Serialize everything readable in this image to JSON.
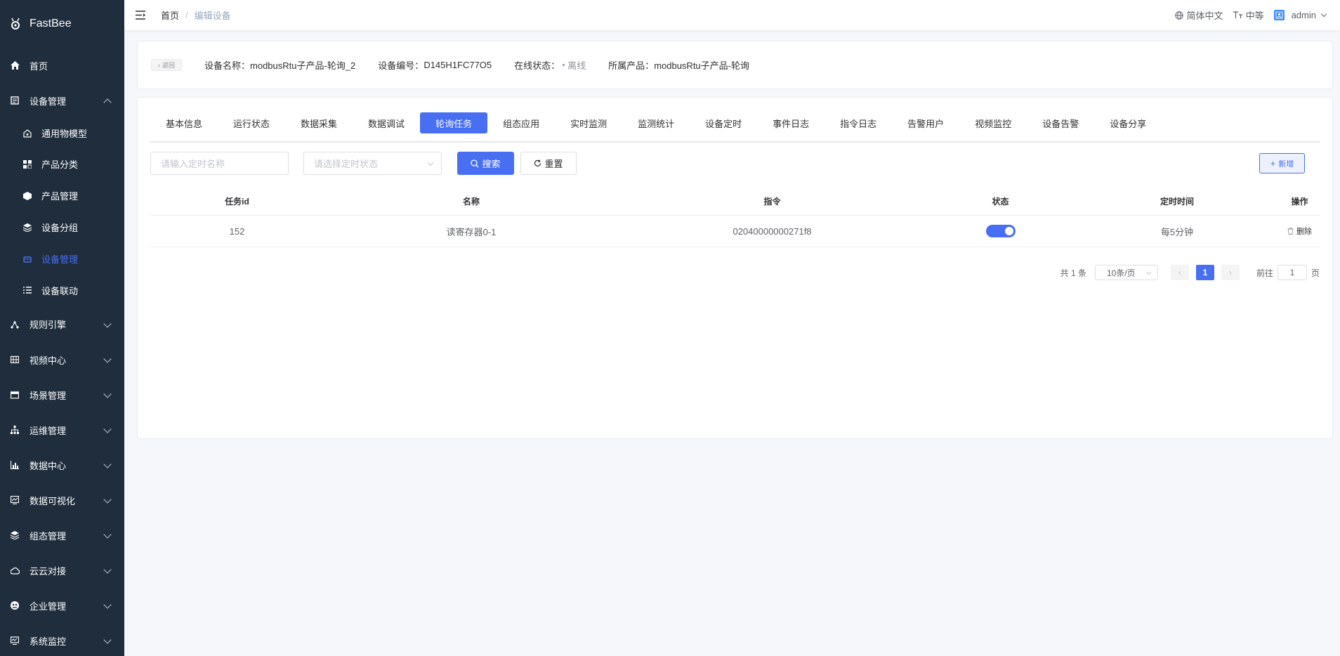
{
  "app": {
    "name": "FastBee"
  },
  "sidebar": {
    "items": [
      {
        "label": "首页",
        "icon": "home-icon"
      },
      {
        "label": "设备管理",
        "icon": "device-icon",
        "expanded": true,
        "children": [
          {
            "label": "通用物模型",
            "icon": "model-icon"
          },
          {
            "label": "产品分类",
            "icon": "category-icon"
          },
          {
            "label": "产品管理",
            "icon": "product-icon"
          },
          {
            "label": "设备分组",
            "icon": "group-icon"
          },
          {
            "label": "设备管理",
            "icon": "device-manage-icon",
            "active": true
          },
          {
            "label": "设备联动",
            "icon": "linkage-icon"
          }
        ]
      },
      {
        "label": "规则引擎",
        "icon": "rule-icon"
      },
      {
        "label": "视频中心",
        "icon": "video-icon"
      },
      {
        "label": "场景管理",
        "icon": "scene-icon"
      },
      {
        "label": "运维管理",
        "icon": "ops-icon"
      },
      {
        "label": "数据中心",
        "icon": "data-icon"
      },
      {
        "label": "数据可视化",
        "icon": "visual-icon"
      },
      {
        "label": "组态管理",
        "icon": "config-icon"
      },
      {
        "label": "云云对接",
        "icon": "cloud-icon"
      },
      {
        "label": "企业管理",
        "icon": "enterprise-icon"
      },
      {
        "label": "系统监控",
        "icon": "monitor-icon"
      }
    ]
  },
  "header": {
    "breadcrumb": {
      "home": "首页",
      "separator": "/",
      "current": "编辑设备"
    },
    "language": "简体中文",
    "font_size": "中等",
    "user": "admin"
  },
  "device_info": {
    "back": "返回",
    "name_label": "设备名称：",
    "name": "modbusRtu子产品-轮询_2",
    "serial_label": "设备编号：",
    "serial": "D145H1FC77O5",
    "status_label": "在线状态：",
    "status": "离线",
    "product_label": "所属产品：",
    "product": "modbusRtu子产品-轮询"
  },
  "tabs": [
    {
      "label": "基本信息"
    },
    {
      "label": "运行状态"
    },
    {
      "label": "数据采集"
    },
    {
      "label": "数据调试"
    },
    {
      "label": "轮询任务",
      "active": true
    },
    {
      "label": "组态应用"
    },
    {
      "label": "实时监测"
    },
    {
      "label": "监测统计"
    },
    {
      "label": "设备定时"
    },
    {
      "label": "事件日志"
    },
    {
      "label": "指令日志"
    },
    {
      "label": "告警用户"
    },
    {
      "label": "视频监控"
    },
    {
      "label": "设备告警"
    },
    {
      "label": "设备分享"
    }
  ],
  "filters": {
    "name_placeholder": "请输入定时名称",
    "status_placeholder": "请选择定时状态",
    "search": "搜索",
    "reset": "重置",
    "add": "新增"
  },
  "table": {
    "columns": [
      "任务id",
      "名称",
      "指令",
      "状态",
      "定时时间",
      "操作"
    ],
    "rows": [
      {
        "id": "152",
        "name": "读寄存器0-1",
        "command": "02040000000271f8",
        "enabled": true,
        "schedule": "每5分钟",
        "action": "删除"
      }
    ]
  },
  "pagination": {
    "total": "共 1 条",
    "page_size": "10条/页",
    "current": "1",
    "goto_prefix": "前往",
    "goto_value": "1",
    "goto_suffix": "页"
  },
  "colors": {
    "primary": "#486ff2",
    "sidebar_bg": "#1f2d3d"
  }
}
